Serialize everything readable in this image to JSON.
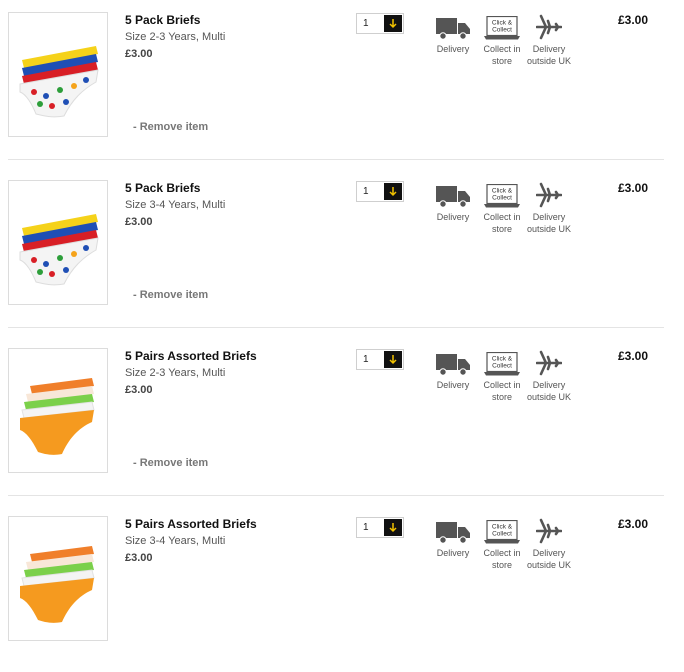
{
  "cart": {
    "items": [
      {
        "name": "5 Pack Briefs",
        "size": "Size 2-3 Years, Multi",
        "unit_price": "£3.00",
        "quantity": "1",
        "remove_label": "- Remove item",
        "line_total": "£3.00",
        "image": "multicolor-briefs-pack"
      },
      {
        "name": "5 Pack Briefs",
        "size": "Size 3-4 Years, Multi",
        "unit_price": "£3.00",
        "quantity": "1",
        "remove_label": "- Remove item",
        "line_total": "£3.00",
        "image": "multicolor-briefs-pack"
      },
      {
        "name": "5 Pairs Assorted Briefs",
        "size": "Size 2-3 Years, Multi",
        "unit_price": "£3.00",
        "quantity": "1",
        "remove_label": "- Remove item",
        "line_total": "£3.00",
        "image": "orange-assorted-briefs"
      },
      {
        "name": "5 Pairs Assorted Briefs",
        "size": "Size 3-4 Years, Multi",
        "unit_price": "£3.00",
        "quantity": "1",
        "remove_label": "",
        "line_total": "£3.00",
        "image": "orange-assorted-briefs"
      }
    ],
    "delivery_options": {
      "delivery": "Delivery",
      "collect_line1": "Collect in",
      "collect_line2": "store",
      "collect_icon_text_line1": "Click &",
      "collect_icon_text_line2": "Collect",
      "outside_line1": "Delivery",
      "outside_line2": "outside UK"
    },
    "colors": {
      "qty_button_bg": "#111111",
      "qty_arrow": "#f2c200",
      "icon_gray": "#555555"
    }
  }
}
